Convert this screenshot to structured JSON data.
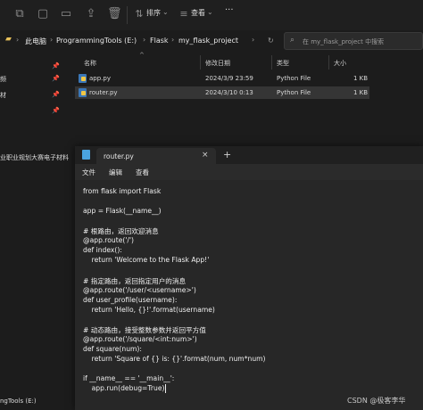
{
  "toolbar": {
    "icons": [
      "copy-icon",
      "paste-icon",
      "share-icon",
      "rename-icon",
      "delete-icon"
    ],
    "sort_label": "排序",
    "view_label": "查看",
    "more_label": "···"
  },
  "address": {
    "crumbs": [
      "此电脑",
      "ProgrammingTools (E:)",
      "Flask",
      "my_flask_project"
    ],
    "search_placeholder": "在 my_flask_project 中搜索"
  },
  "nav": {
    "items": [
      "频",
      "材",
      "",
      "",
      "业职业规划大赛电子材料",
      "ngTools (E:)"
    ]
  },
  "columns": [
    "名称",
    "修改日期",
    "类型",
    "大小"
  ],
  "files": [
    {
      "name": "app.py",
      "modified": "2024/3/9 23:59",
      "type": "Python File",
      "size": "1 KB"
    },
    {
      "name": "router.py",
      "modified": "2024/3/10 0:13",
      "type": "Python File",
      "size": "1 KB"
    }
  ],
  "notepad": {
    "tab_title": "router.py",
    "close_glyph": "×",
    "new_tab_glyph": "+",
    "menu": [
      "文件",
      "编辑",
      "查看"
    ],
    "code_lines": [
      "from flask import Flask",
      "",
      "app = Flask(__name__)",
      "",
      "# 根路由，返回欢迎消息",
      "@app.route('/')",
      "def index():",
      "    return 'Welcome to the Flask App!'",
      "",
      "# 指定路由，返回指定用户的消息",
      "@app.route('/user/<username>')",
      "def user_profile(username):",
      "    return 'Hello, {}!'.format(username)",
      "",
      "# 动态路由，接受整数参数并返回平方值",
      "@app.route('/square/<int:num>')",
      "def square(num):",
      "    return 'Square of {} is: {}'.format(num, num*num)",
      "",
      "if __name__ == '__main__':",
      "    app.run(debug=True)"
    ]
  },
  "watermark": "CSDN @极客李华"
}
